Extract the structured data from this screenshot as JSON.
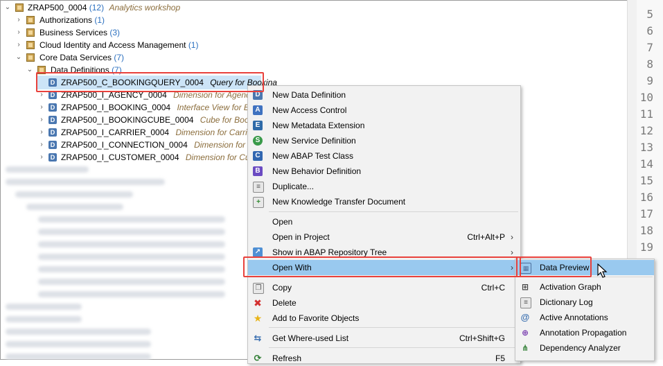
{
  "tree": {
    "root": {
      "name": "ZRAP500_0004",
      "count": "(12)",
      "desc": "Analytics workshop"
    },
    "children": [
      {
        "name": "Authorizations",
        "count": "(1)"
      },
      {
        "name": "Business Services",
        "count": "(3)"
      },
      {
        "name": "Cloud Identity and Access Management",
        "count": "(1)"
      },
      {
        "name": "Core Data Services",
        "count": "(7)"
      }
    ],
    "data_definitions": {
      "name": "Data Definitions",
      "count": "(7)"
    },
    "items": [
      {
        "name": "ZRAP500_C_BOOKINGQUERY_0004",
        "desc": "Query for Bookina"
      },
      {
        "name": "ZRAP500_I_AGENCY_0004",
        "desc": "Dimension for Agency"
      },
      {
        "name": "ZRAP500_I_BOOKING_0004",
        "desc": "Interface View for Book"
      },
      {
        "name": "ZRAP500_I_BOOKINGCUBE_0004",
        "desc": "Cube for Booking"
      },
      {
        "name": "ZRAP500_I_CARRIER_0004",
        "desc": "Dimension for Carrier"
      },
      {
        "name": "ZRAP500_I_CONNECTION_0004",
        "desc": "Dimension for Cor"
      },
      {
        "name": "ZRAP500_I_CUSTOMER_0004",
        "desc": "Dimension for Custor"
      }
    ]
  },
  "line_numbers": [
    "5",
    "6",
    "7",
    "8",
    "9",
    "10",
    "11",
    "12",
    "13",
    "14",
    "15",
    "16",
    "17",
    "18",
    "19"
  ],
  "menu": {
    "items": [
      {
        "label": "New Data Definition",
        "icon": "data-definition-icon"
      },
      {
        "label": "New Access Control",
        "icon": "access-control-icon"
      },
      {
        "label": "New Metadata Extension",
        "icon": "metadata-extension-icon"
      },
      {
        "label": "New Service Definition",
        "icon": "service-definition-icon"
      },
      {
        "label": "New ABAP Test Class",
        "icon": "test-class-icon"
      },
      {
        "label": "New Behavior Definition",
        "icon": "behavior-definition-icon"
      },
      {
        "label": "Duplicate...",
        "icon": "duplicate-icon"
      },
      {
        "label": "New Knowledge Transfer Document",
        "icon": "knowledge-transfer-icon"
      },
      {
        "label": "Open"
      },
      {
        "label": "Open in Project",
        "shortcut": "Ctrl+Alt+P"
      },
      {
        "label": "Show in ABAP Repository Tree"
      },
      {
        "label": "Open With"
      },
      {
        "label": "Copy",
        "shortcut": "Ctrl+C",
        "icon": "copy-icon"
      },
      {
        "label": "Delete",
        "icon": "delete-icon"
      },
      {
        "label": "Add to Favorite Objects",
        "icon": "star-icon"
      },
      {
        "label": "Get Where-used List",
        "shortcut": "Ctrl+Shift+G",
        "icon": "where-used-icon"
      },
      {
        "label": "Refresh",
        "shortcut": "F5",
        "icon": "refresh-icon"
      }
    ]
  },
  "submenu": {
    "items": [
      {
        "label": "Data Preview",
        "icon": "data-preview-icon"
      },
      {
        "label": "Activation Graph",
        "icon": "activation-graph-icon"
      },
      {
        "label": "Dictionary Log",
        "icon": "dictionary-log-icon"
      },
      {
        "label": "Active Annotations",
        "icon": "annotations-icon"
      },
      {
        "label": "Annotation Propagation",
        "icon": "annotation-propagation-icon"
      },
      {
        "label": "Dependency Analyzer",
        "icon": "dependency-analyzer-icon"
      }
    ]
  },
  "colors": {
    "highlight": "#99c9ef",
    "red_box": "#e8413c",
    "count": "#2a6fbf",
    "desc": "#8b6d3c"
  }
}
